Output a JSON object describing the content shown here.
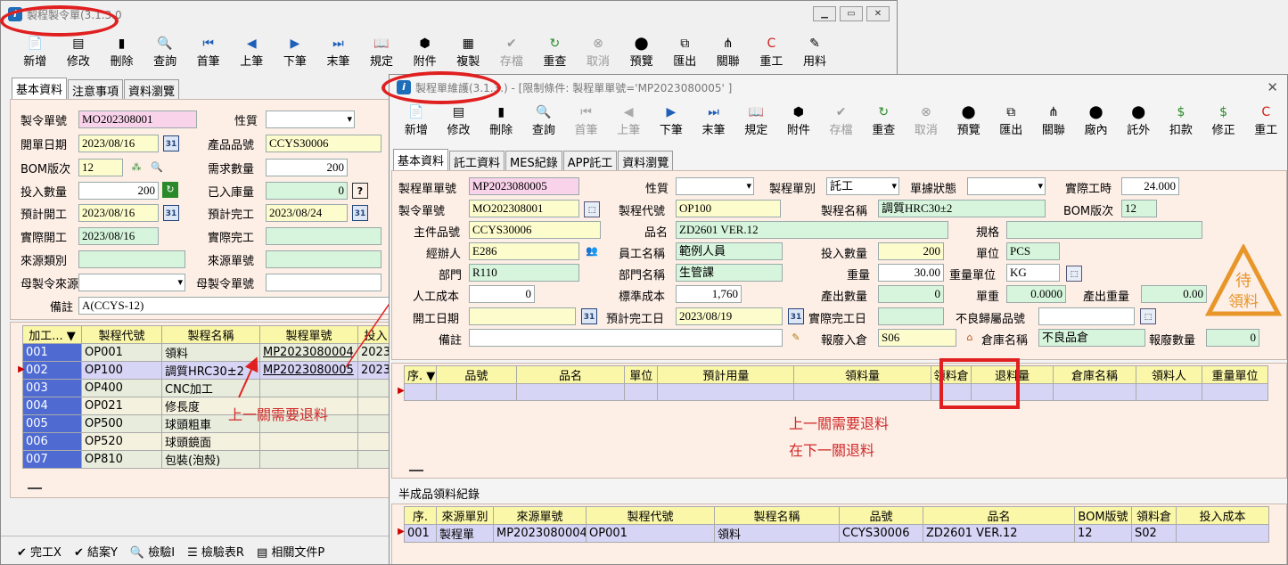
{
  "back_window": {
    "title": "製程製令單(3.1.3.0",
    "toolbar": [
      {
        "icon": "new-icon",
        "label": "新增",
        "enabled": true
      },
      {
        "icon": "edit-icon",
        "label": "修改",
        "enabled": true
      },
      {
        "icon": "delete-icon",
        "label": "刪除",
        "enabled": true
      },
      {
        "icon": "search-icon",
        "label": "查詢",
        "enabled": true
      },
      {
        "icon": "first-icon",
        "label": "首筆",
        "enabled": true
      },
      {
        "icon": "prev-icon",
        "label": "上筆",
        "enabled": true
      },
      {
        "icon": "next-icon",
        "label": "下筆",
        "enabled": true
      },
      {
        "icon": "last-icon",
        "label": "末筆",
        "enabled": true
      },
      {
        "icon": "rule-icon",
        "label": "規定",
        "enabled": true
      },
      {
        "icon": "attach-icon",
        "label": "附件",
        "enabled": true
      },
      {
        "icon": "copy-icon",
        "label": "複製",
        "enabled": true
      },
      {
        "icon": "save-icon",
        "label": "存檔",
        "enabled": false
      },
      {
        "icon": "refresh-icon",
        "label": "重查",
        "enabled": true
      },
      {
        "icon": "cancel-icon",
        "label": "取消",
        "enabled": false
      },
      {
        "icon": "preview-icon",
        "label": "預覽",
        "enabled": true
      },
      {
        "icon": "export-icon",
        "label": "匯出",
        "enabled": true
      },
      {
        "icon": "link-icon",
        "label": "關聯",
        "enabled": true
      },
      {
        "icon": "rework-icon",
        "label": "重工",
        "enabled": true
      },
      {
        "icon": "material-icon",
        "label": "用料",
        "enabled": true
      }
    ],
    "tabs": [
      "基本資料",
      "注意事項",
      "資料瀏覽"
    ],
    "fields": {
      "order_no_label": "製令單號",
      "order_no": "MO202308001",
      "nature_label": "性質",
      "nature": "",
      "open_date_label": "開單日期",
      "open_date": "2023/08/16",
      "product_no_label": "產品品號",
      "product_no": "CCYS30006",
      "bom_label": "BOM版次",
      "bom": "12",
      "demand_label": "需求數量",
      "demand": "200",
      "input_qty_label": "投入數量",
      "input_qty": "200",
      "stocked_label": "已入庫量",
      "stocked": "0",
      "plan_start_label": "預計開工",
      "plan_start": "2023/08/16",
      "plan_end_label": "預計完工",
      "plan_end": "2023/08/24",
      "actual_start_label": "實際開工",
      "actual_start": "2023/08/16",
      "actual_end_label": "實際完工",
      "actual_end": "",
      "source_type_label": "來源類別",
      "source_type": "",
      "source_no_label": "來源單號",
      "source_no": "",
      "parent_src_label": "母製令來源",
      "parent_src": "",
      "parent_no_label": "母製令單號",
      "parent_no": "",
      "remark_label": "備註",
      "remark": "A(CCYS-12)"
    },
    "grid_headers": [
      "加工...",
      "製程代號",
      "製程名稱",
      "製程單號",
      "投入"
    ],
    "grid_rows": [
      {
        "seq": "001",
        "code": "OP001",
        "name": "領料",
        "mp": "MP2023080004",
        "date": "2023/"
      },
      {
        "seq": "002",
        "code": "OP100",
        "name": "調質HRC30±2",
        "mp": "MP2023080005",
        "date": "2023/"
      },
      {
        "seq": "003",
        "code": "OP400",
        "name": "CNC加工",
        "mp": "",
        "date": ""
      },
      {
        "seq": "004",
        "code": "OP021",
        "name": "修長度",
        "mp": "",
        "date": ""
      },
      {
        "seq": "005",
        "code": "OP500",
        "name": "球頭粗車",
        "mp": "",
        "date": ""
      },
      {
        "seq": "006",
        "code": "OP520",
        "name": "球頭鏡面",
        "mp": "",
        "date": ""
      },
      {
        "seq": "007",
        "code": "OP810",
        "name": "包裝(泡殼)",
        "mp": "",
        "date": ""
      }
    ],
    "bottom_buttons": [
      "完工X",
      "結案Y",
      "檢驗I",
      "檢驗表R",
      "相關文件P"
    ],
    "annotation": "上一關需要退料"
  },
  "front_window": {
    "title": "製程單維護(3.1.3.",
    "title_suffix": ") - [限制條件: 製程單單號='MP2023080005' ]",
    "toolbar": [
      {
        "icon": "new-icon",
        "label": "新增",
        "enabled": true
      },
      {
        "icon": "edit-icon",
        "label": "修改",
        "enabled": true
      },
      {
        "icon": "delete-icon",
        "label": "刪除",
        "enabled": true
      },
      {
        "icon": "search-icon",
        "label": "查詢",
        "enabled": true
      },
      {
        "icon": "first-icon",
        "label": "首筆",
        "enabled": false
      },
      {
        "icon": "prev-icon",
        "label": "上筆",
        "enabled": false
      },
      {
        "icon": "next-icon",
        "label": "下筆",
        "enabled": true
      },
      {
        "icon": "last-icon",
        "label": "末筆",
        "enabled": true
      },
      {
        "icon": "rule-icon",
        "label": "規定",
        "enabled": true
      },
      {
        "icon": "attach-icon",
        "label": "附件",
        "enabled": true
      },
      {
        "icon": "save-icon",
        "label": "存檔",
        "enabled": false
      },
      {
        "icon": "refresh-icon",
        "label": "重查",
        "enabled": true
      },
      {
        "icon": "cancel-icon",
        "label": "取消",
        "enabled": false
      },
      {
        "icon": "preview-icon",
        "label": "預覽",
        "enabled": true
      },
      {
        "icon": "export-icon",
        "label": "匯出",
        "enabled": true
      },
      {
        "icon": "link-icon",
        "label": "關聯",
        "enabled": true
      },
      {
        "icon": "inhouse-icon",
        "label": "廠內",
        "enabled": true
      },
      {
        "icon": "outsource-icon",
        "label": "託外",
        "enabled": true
      },
      {
        "icon": "deduct-icon",
        "label": "扣款",
        "enabled": true
      },
      {
        "icon": "correct-icon",
        "label": "修正",
        "enabled": true
      },
      {
        "icon": "rework-icon",
        "label": "重工",
        "enabled": true
      }
    ],
    "tabs": [
      "基本資料",
      "託工資料",
      "MES紀錄",
      "APP託工",
      "資料瀏覽"
    ],
    "fields": {
      "mp_no_label": "製程單單號",
      "mp_no": "MP2023080005",
      "nature_label": "性質",
      "nature": "",
      "mp_type_label": "製程單別",
      "mp_type": "託工",
      "doc_status_label": "單據狀態",
      "doc_status": "",
      "actual_hours_label": "實際工時",
      "actual_hours": "24.000",
      "mo_no_label": "製令單號",
      "mo_no": "MO202308001",
      "proc_code_label": "製程代號",
      "proc_code": "OP100",
      "proc_name_label": "製程名稱",
      "proc_name": "調質HRC30±2",
      "bom_label": "BOM版次",
      "bom": "12",
      "main_item_label": "主件品號",
      "main_item": "CCYS30006",
      "item_name_label": "品名",
      "item_name": "ZD2601 VER.12",
      "spec_label": "規格",
      "spec": "",
      "handler_label": "經辦人",
      "handler": "E286",
      "emp_name_label": "員工名稱",
      "emp_name": "範例人員",
      "input_qty_label": "投入數量",
      "input_qty": "200",
      "unit_label": "單位",
      "unit": "PCS",
      "dept_label": "部門",
      "dept": "R110",
      "dept_name_label": "部門名稱",
      "dept_name": "生管課",
      "weight_label": "重量",
      "weight": "30.00",
      "weight_unit_label": "重量單位",
      "weight_unit": "KG",
      "labor_cost_label": "人工成本",
      "labor_cost": "0",
      "std_cost_label": "標準成本",
      "std_cost": "1,760",
      "output_qty_label": "產出數量",
      "output_qty": "0",
      "unit_weight_label": "單重",
      "unit_weight": "0.0000",
      "output_weight_label": "產出重量",
      "output_weight": "0.00",
      "open_date_label": "開工日期",
      "open_date": "",
      "plan_done_label": "預計完工日",
      "plan_done": "2023/08/19",
      "actual_done_label": "實際完工日",
      "actual_done": "",
      "defect_item_label": "不良歸屬品號",
      "defect_item": "",
      "remark_label": "備註",
      "remark": "",
      "scrap_wh_label": "報廢入倉",
      "scrap_wh": "S06",
      "wh_name_label": "倉庫名稱",
      "wh_name": "不良品倉",
      "scrap_qty_label": "報廢數量",
      "scrap_qty": "0"
    },
    "badge": {
      "line1": "待",
      "line2": "領料",
      "color": "#e8962a"
    },
    "mat_headers": [
      "序.",
      "品號",
      "品名",
      "單位",
      "預計用量",
      "領料量",
      "領料倉",
      "退料量",
      "倉庫名稱",
      "領料人",
      "重量單位"
    ],
    "note1": "上一關需要退料",
    "note2": "在下一關退料",
    "semi_title": "半成品領料紀錄",
    "semi_headers": [
      "序.",
      "來源單別",
      "來源單號",
      "製程代號",
      "製程名稱",
      "品號",
      "品名",
      "BOM版號",
      "領料倉",
      "投入成本"
    ],
    "semi_rows": [
      {
        "seq": "001",
        "src_type": "製程單",
        "src_no": "MP2023080004",
        "code": "OP001",
        "name": "領料",
        "item": "CCYS30006",
        "item_name": "ZD2601 VER.12",
        "bom": "12",
        "wh": "S02",
        "cost": ""
      }
    ]
  },
  "colors": {
    "highlight_red": "#e02020",
    "note_red": "#d02a2a",
    "pink_field": "#f9d3ea",
    "yellow_field": "#fdfccc",
    "green_field": "#d6f5dc"
  }
}
